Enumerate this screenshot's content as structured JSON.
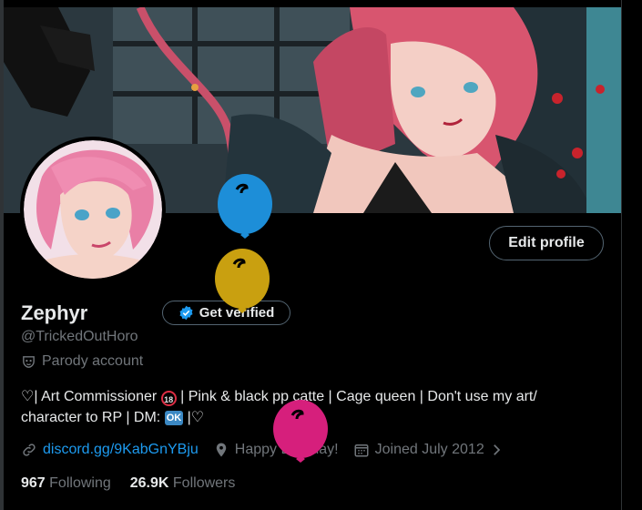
{
  "profile": {
    "name": "Zephyr",
    "handle": "@TrickedOutHoro",
    "parody_label": "Parody account",
    "bio_line1_start": "♡| Art Commissioner ",
    "bio_line1_badge": "18",
    "bio_line1_end": " | Pink & black pp catte | Cage queen | Don't use my art/",
    "bio_line2_start": "character to RP | DM: ",
    "bio_line2_ok": "OK",
    "bio_line2_end": " |♡",
    "link": "discord.gg/9KabGnYBju",
    "location": "Happy Birthday!",
    "joined": "Joined July 2012",
    "following_count": "967",
    "following_label": "Following",
    "followers_count": "26.9K",
    "followers_label": "Followers"
  },
  "actions": {
    "edit_profile": "Edit profile",
    "get_verified": "Get verified"
  },
  "icons": {
    "verified_badge": "verified-badge-icon",
    "parody": "mask-icon",
    "link": "link-icon",
    "location": "location-pin-icon",
    "calendar": "calendar-icon",
    "chevron": "chevron-right-icon"
  },
  "colors": {
    "accent": "#1d9bf0",
    "muted": "#71767b",
    "text": "#e7e9ea",
    "balloon_blue": "#1d8ed8",
    "balloon_gold": "#c9a010",
    "balloon_pink": "#d61f7c"
  }
}
